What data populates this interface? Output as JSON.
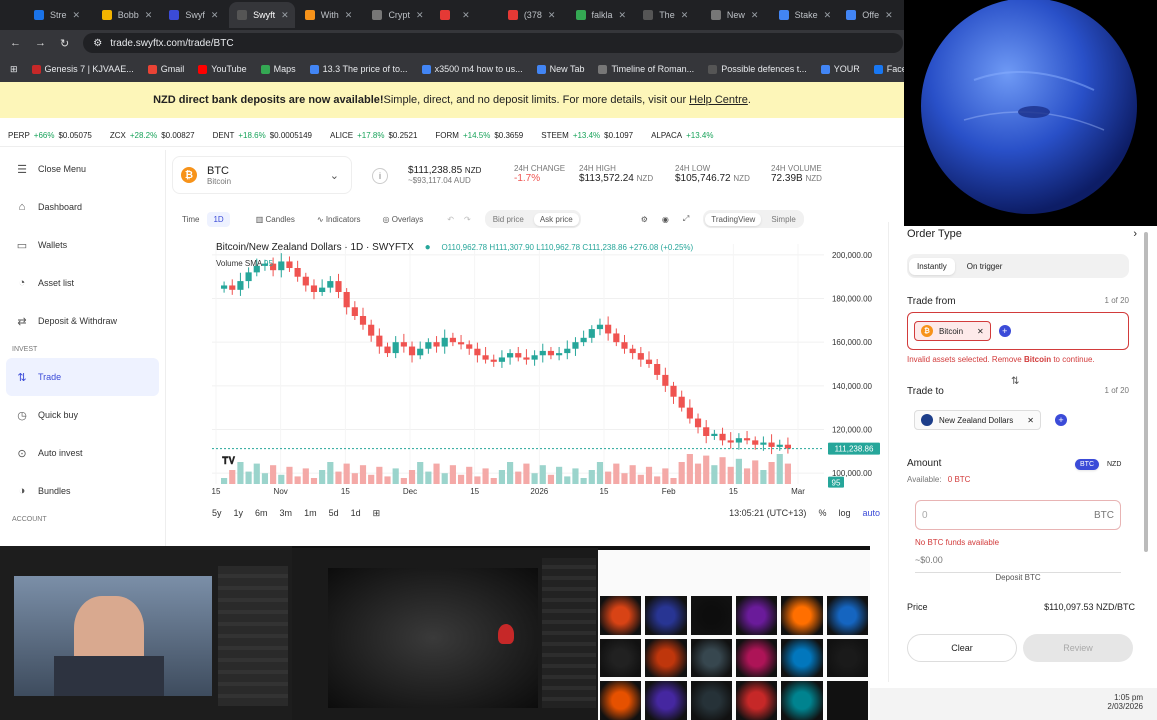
{
  "browser": {
    "tabs": [
      {
        "label": "Stre",
        "color": "#1a73e8"
      },
      {
        "label": "Bobb",
        "color": "#f4b400"
      },
      {
        "label": "Swyf",
        "color": "#3b4bd8"
      },
      {
        "label": "Swyft",
        "color": "#555"
      },
      {
        "label": "With",
        "color": "#f7931a"
      },
      {
        "label": "Crypt",
        "color": "#777"
      },
      {
        "label": "",
        "color": "#e53935"
      },
      {
        "label": "(378",
        "color": "#e53935"
      },
      {
        "label": "falkla",
        "color": "#34a853"
      },
      {
        "label": "The",
        "color": "#555"
      },
      {
        "label": "New",
        "color": "#777"
      },
      {
        "label": "Stake",
        "color": "#4285f4"
      },
      {
        "label": "Offe",
        "color": "#4285f4"
      }
    ],
    "url": "trade.swyftx.com/trade/BTC",
    "bookmarks": [
      "Genesis 7 | KJVAAE...",
      "Gmail",
      "YouTube",
      "Maps",
      "13.3 The price of to...",
      "x3500 m4 how to us...",
      "New Tab",
      "Timeline of Roman...",
      "Possible defences t...",
      "YOUR",
      "Facebook green"
    ]
  },
  "banner": {
    "bold": "NZD direct bank deposits are now available!",
    "text": " Simple, direct, and no deposit limits. For more details, visit our",
    "link": "Help Centre",
    "end": "."
  },
  "ticker": [
    {
      "sym": "PERP",
      "pct": "+66%",
      "price": "$0.05075"
    },
    {
      "sym": "ZCX",
      "pct": "+28.2%",
      "price": "$0.00827"
    },
    {
      "sym": "DENT",
      "pct": "+18.6%",
      "price": "$0.0005149"
    },
    {
      "sym": "ALICE",
      "pct": "+17.8%",
      "price": "$0.2521"
    },
    {
      "sym": "FORM",
      "pct": "+14.5%",
      "price": "$0.3659"
    },
    {
      "sym": "STEEM",
      "pct": "+13.4%",
      "price": "$0.1097"
    },
    {
      "sym": "ALPACA",
      "pct": "+13.4%",
      "price": ""
    }
  ],
  "sidebar": {
    "close": "Close Menu",
    "items": [
      {
        "label": "Dashboard",
        "icon": "home-icon"
      },
      {
        "label": "Wallets",
        "icon": "wallet-icon"
      },
      {
        "label": "Asset list",
        "icon": "list-icon"
      },
      {
        "label": "Deposit & Withdraw",
        "icon": "transfer-icon"
      }
    ],
    "invest_header": "INVEST",
    "invest_items": [
      {
        "label": "Trade",
        "icon": "trade-icon",
        "active": true
      },
      {
        "label": "Quick buy",
        "icon": "quickbuy-icon"
      },
      {
        "label": "Auto invest",
        "icon": "autoinvest-icon"
      },
      {
        "label": "Bundles",
        "icon": "bundles-icon"
      }
    ],
    "account_header": "ACCOUNT"
  },
  "coin": {
    "name": "BTC",
    "full": "Bitcoin",
    "price": "$111,238.85",
    "price_ccy": "NZD",
    "price_aud": "~$93,117.04 AUD",
    "change_label": "24H CHANGE",
    "change": "-1.7%",
    "high_label": "24H HIGH",
    "high": "$113,572.24",
    "high_ccy": "NZD",
    "low_label": "24H LOW",
    "low": "$105,746.72",
    "low_ccy": "NZD",
    "vol_label": "24H VOLUME",
    "vol": "72.39B",
    "vol_ccy": "NZD"
  },
  "chart_toolbar": {
    "time": "Time",
    "interval": "1D",
    "candles": "Candles",
    "indicators": "Indicators",
    "overlays": "Overlays",
    "bid": "Bid price",
    "ask": "Ask price",
    "tradingview": "TradingView",
    "simple": "Simple"
  },
  "chart_data": {
    "type": "candlestick",
    "title": "Bitcoin/New Zealand Dollars · 1D · SWYFTX",
    "ohlc_label": "O110,962.78 H111,307.90 L110,962.78 C111,238.86 +276.08 (+0.25%)",
    "volume_label": "Volume SMA",
    "volume_sma": "95",
    "y_ticks": [
      100000,
      120000,
      140000,
      160000,
      180000,
      200000
    ],
    "y_tick_labels": [
      "100,000.00",
      "120,000.00",
      "140,000.00",
      "160,000.00",
      "180,000.00",
      "200,000.00"
    ],
    "ylim": [
      95000,
      205000
    ],
    "x_labels": [
      "15",
      "Nov",
      "15",
      "Dec",
      "15",
      "2026",
      "15",
      "Feb",
      "15",
      "Mar"
    ],
    "last_price": 111238.86,
    "last_price_label": "111,238.86",
    "volume_badge": "95",
    "closes": [
      186000,
      184000,
      188000,
      192000,
      195000,
      196000,
      193000,
      197000,
      194000,
      190000,
      186000,
      183000,
      185000,
      188000,
      183000,
      176000,
      172000,
      168000,
      163000,
      158000,
      155000,
      160000,
      158000,
      154000,
      157000,
      160000,
      158000,
      162000,
      160000,
      159000,
      157000,
      154000,
      152000,
      151000,
      153000,
      155000,
      153000,
      152000,
      154000,
      156000,
      154000,
      155000,
      157000,
      160000,
      162000,
      166000,
      168000,
      164000,
      160000,
      157000,
      155000,
      152000,
      150000,
      145000,
      140000,
      135000,
      130000,
      125000,
      121000,
      117000,
      118000,
      115000,
      114000,
      116000,
      115000,
      113000,
      114000,
      112000,
      113000,
      111238
    ]
  },
  "chart_bottom": {
    "ranges": [
      "5y",
      "1y",
      "6m",
      "3m",
      "1m",
      "5d",
      "1d"
    ],
    "time": "13:05:21 (UTC+13)",
    "pct": "%",
    "log": "log",
    "auto": "auto"
  },
  "order": {
    "title": "Order Type",
    "instantly": "Instantly",
    "trigger": "On trigger",
    "from_label": "Trade from",
    "from_count": "1 of 20",
    "from_asset": "Bitcoin",
    "error_pre": "Invalid assets selected. Remove",
    "error_bold": "Bitcoin",
    "error_post": "to continue.",
    "to_label": "Trade to",
    "to_count": "1 of 20",
    "to_asset": "New Zealand Dollars",
    "amount_label": "Amount",
    "toggle_btc": "BTC",
    "toggle_nzd": "NZD",
    "available_label": "Available:",
    "available": "0 BTC",
    "amount_value": "0",
    "amount_unit": "BTC",
    "no_funds": "No BTC funds available",
    "approx": "~$0.00",
    "deposit": "Deposit BTC",
    "price_label": "Price",
    "price": "$110,097.53 NZD/BTC",
    "clear": "Clear",
    "review": "Review"
  },
  "taskbar": {
    "time": "1:05 pm",
    "date": "2/03/2026"
  },
  "colors": {
    "accent": "#3b4bd8",
    "up": "#26a69a",
    "down": "#ef5350",
    "banner": "#fdf6b9"
  }
}
